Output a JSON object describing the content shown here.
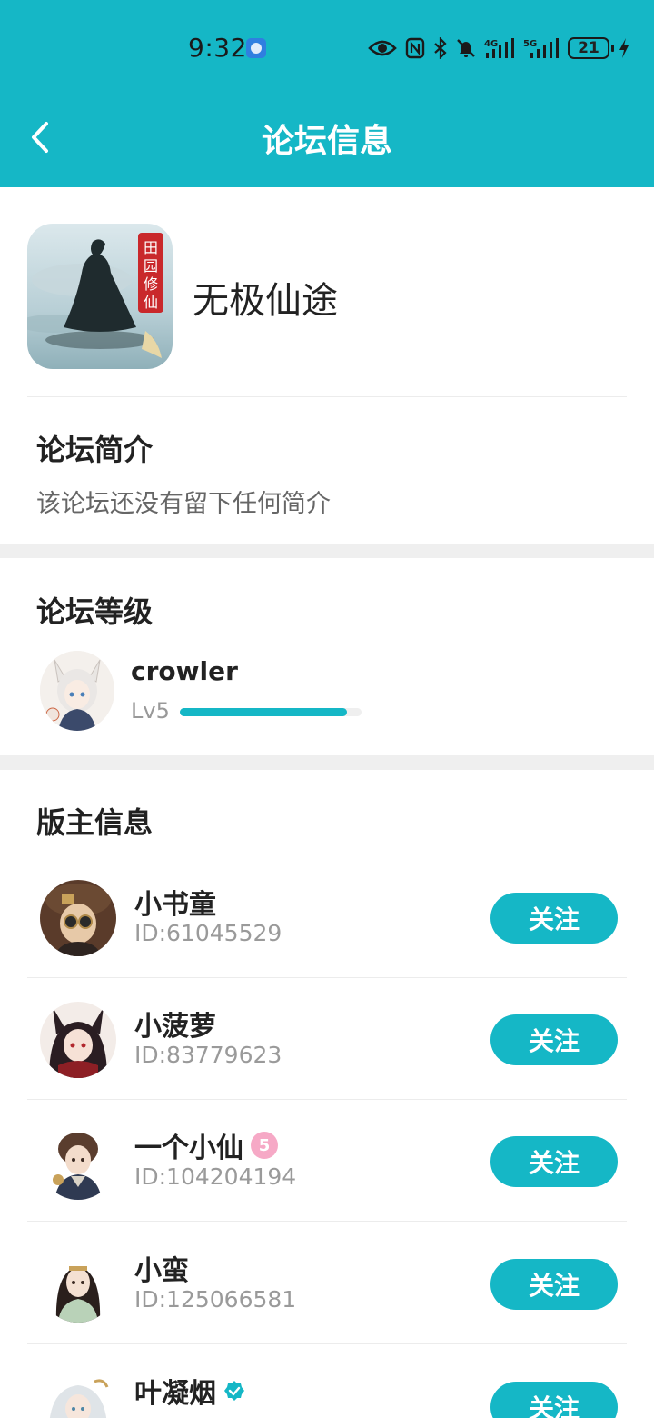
{
  "status_bar": {
    "time": "9:32",
    "battery": "21",
    "icons": [
      "eye-icon",
      "nfc-icon",
      "bluetooth-icon",
      "mute-icon",
      "signal-4g-icon",
      "signal-5g-icon",
      "battery-icon",
      "charging-icon"
    ]
  },
  "header": {
    "title": "论坛信息",
    "back_icon": "chevron-left-icon",
    "background": "#15b7c6"
  },
  "forum": {
    "name": "无极仙途",
    "icon_badge_text": "田园修仙"
  },
  "intro": {
    "title": "论坛简介",
    "text": "该论坛还没有留下任何简介"
  },
  "level": {
    "title": "论坛等级",
    "username": "crowler",
    "level_label": "Lv5",
    "progress": 0.92
  },
  "moderators": {
    "title": "版主信息",
    "follow_label": "关注",
    "items": [
      {
        "name": "小书童",
        "id": "ID:61045529",
        "badge": ""
      },
      {
        "name": "小菠萝",
        "id": "ID:83779623",
        "badge": ""
      },
      {
        "name": "一个小仙",
        "id": "ID:104204194",
        "badge": "pink-level-icon"
      },
      {
        "name": "小蛮",
        "id": "ID:125066581",
        "badge": ""
      },
      {
        "name": "叶凝烟",
        "id": "",
        "badge": "verified-icon"
      }
    ]
  },
  "colors": {
    "accent": "#15b7c6",
    "divider": "#efefef",
    "muted_text": "#9a9a9a"
  }
}
